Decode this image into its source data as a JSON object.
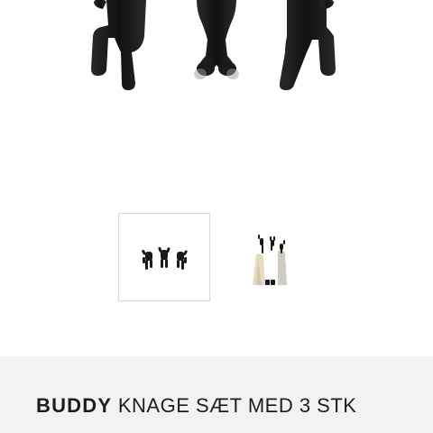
{
  "gallery": {
    "main_image_icon": "climbing-figures-hooks",
    "thumbnails": [
      {
        "icon": "three-hooks-white-background",
        "selected": true
      },
      {
        "icon": "hooks-with-towels-in-use",
        "selected": false
      }
    ]
  },
  "product": {
    "brand": "BUDDY",
    "name": "KNAGE SÆT MED 3 STK"
  },
  "colors": {
    "figure": "#1a1a1a",
    "info_bar_background": "#f3f2f0",
    "selected_border": "#d9d9d9"
  }
}
